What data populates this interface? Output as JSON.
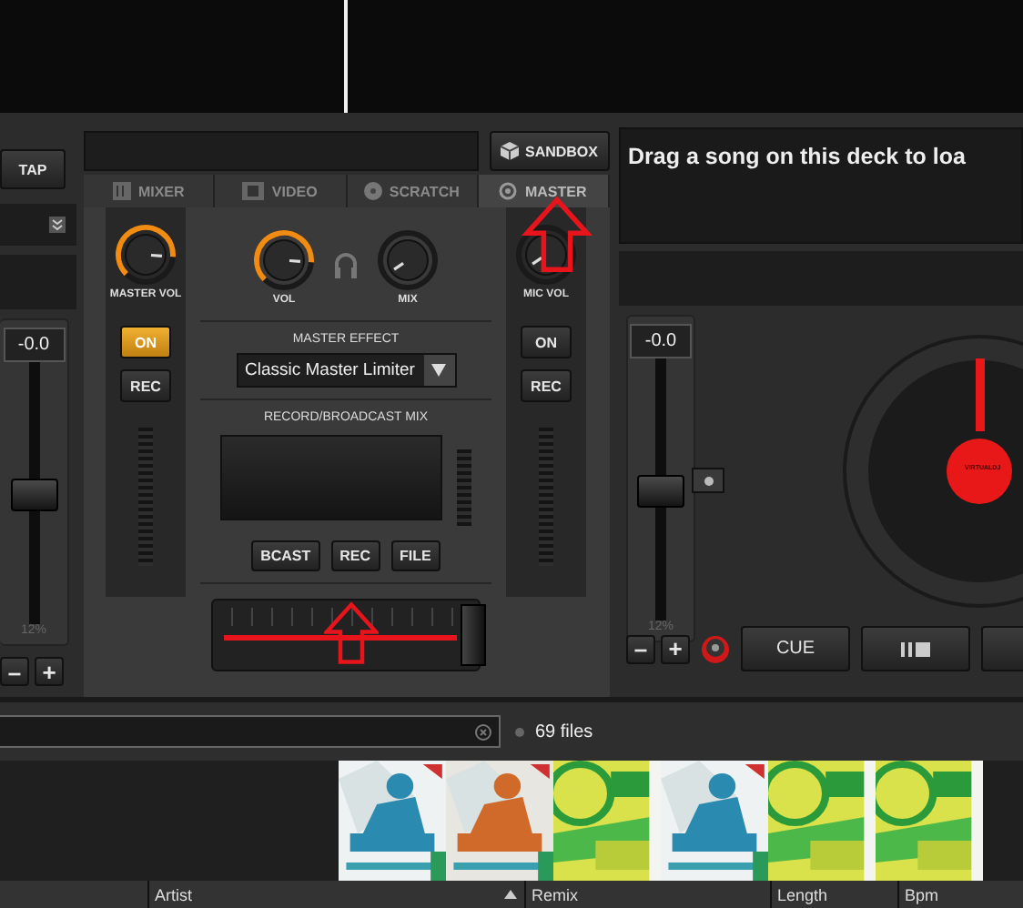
{
  "left_deck": {
    "tap_button": "TAP",
    "pitch_display": "-0.0",
    "pitch_fader": {
      "level": 0.5
    },
    "pitch_range": "12%",
    "minus_button": "–",
    "plus_button": "+"
  },
  "mixer": {
    "sandbox_button": "SANDBOX",
    "tabs": [
      {
        "label": "MIXER",
        "selected": false
      },
      {
        "label": "VIDEO",
        "selected": false
      },
      {
        "label": "SCRATCH",
        "selected": false
      },
      {
        "label": "MASTER",
        "selected": true
      }
    ],
    "master_vol": {
      "label": "MASTER VOL",
      "lit": true
    },
    "vol": {
      "label": "VOL",
      "lit": true
    },
    "mix": {
      "label": "MIX",
      "lit": false
    },
    "mic_vol": {
      "label": "MIC VOL",
      "lit": false
    },
    "master_on": {
      "label": "ON",
      "on": true
    },
    "master_rec": "REC",
    "mic_on": {
      "label": "ON",
      "on": false
    },
    "mic_rec": "REC",
    "effect_label": "MASTER EFFECT",
    "effect_value": "Classic Master Limiter",
    "record_label": "RECORD/BROADCAST MIX",
    "record_buttons": [
      "BCAST",
      "REC",
      "FILE"
    ],
    "crossfader": {
      "level": 0.97
    }
  },
  "right_deck": {
    "title": "Drag a song on this deck to loa",
    "pitch_display": "-0.0",
    "pitch_fader": {
      "level": 0.5
    },
    "pitch_range": "12%",
    "minus_button": "–",
    "plus_button": "+",
    "platter_label": "VIRTUALDJ",
    "cue_button": "CUE"
  },
  "browser": {
    "file_count": "69 files",
    "columns": [
      {
        "label": "Artist",
        "sorted": true
      },
      {
        "label": "Remix",
        "sorted": false
      },
      {
        "label": "Length",
        "sorted": false
      },
      {
        "label": "Bpm",
        "sorted": false
      }
    ]
  }
}
